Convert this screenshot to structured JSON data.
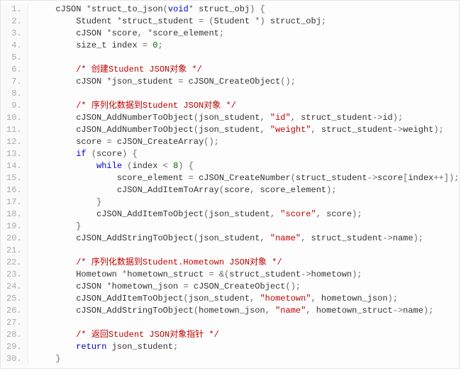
{
  "lines": [
    {
      "n": "1.",
      "indent": 1,
      "tokens": [
        [
          "ident",
          "cJSON "
        ],
        [
          "op",
          "*"
        ],
        [
          "ident",
          "struct_to_json"
        ],
        [
          "punct",
          "("
        ],
        [
          "kw-void",
          "void"
        ],
        [
          "op",
          "* "
        ],
        [
          "ident",
          "struct_obj"
        ],
        [
          "punct",
          ") {"
        ]
      ]
    },
    {
      "n": "2.",
      "indent": 2,
      "tokens": [
        [
          "ident",
          "Student "
        ],
        [
          "op",
          "*"
        ],
        [
          "ident",
          "struct_student "
        ],
        [
          "op",
          "= "
        ],
        [
          "punct",
          "("
        ],
        [
          "ident",
          "Student "
        ],
        [
          "op",
          "*"
        ],
        [
          "punct",
          ") "
        ],
        [
          "ident",
          "struct_obj"
        ],
        [
          "punct",
          ";"
        ]
      ]
    },
    {
      "n": "3.",
      "indent": 2,
      "tokens": [
        [
          "ident",
          "cJSON "
        ],
        [
          "op",
          "*"
        ],
        [
          "ident",
          "score"
        ],
        [
          "punct",
          ", "
        ],
        [
          "op",
          "*"
        ],
        [
          "ident",
          "score_element"
        ],
        [
          "punct",
          ";"
        ]
      ]
    },
    {
      "n": "4.",
      "indent": 2,
      "tokens": [
        [
          "ident",
          "size_t "
        ],
        [
          "ident",
          "index "
        ],
        [
          "op",
          "= "
        ],
        [
          "num",
          "0"
        ],
        [
          "punct",
          ";"
        ]
      ]
    },
    {
      "n": "5.",
      "indent": 0,
      "tokens": []
    },
    {
      "n": "6.",
      "indent": 2,
      "tokens": [
        [
          "comment",
          "/* 创建Student JSON对象 */"
        ]
      ]
    },
    {
      "n": "7.",
      "indent": 2,
      "tokens": [
        [
          "ident",
          "cJSON "
        ],
        [
          "op",
          "*"
        ],
        [
          "ident",
          "json_student "
        ],
        [
          "op",
          "= "
        ],
        [
          "ident",
          "cJSON_CreateObject"
        ],
        [
          "punct",
          "();"
        ]
      ]
    },
    {
      "n": "8.",
      "indent": 0,
      "tokens": []
    },
    {
      "n": "9.",
      "indent": 2,
      "tokens": [
        [
          "comment",
          "/* 序列化数据到Student JSON对象 */"
        ]
      ]
    },
    {
      "n": "10.",
      "indent": 2,
      "tokens": [
        [
          "ident",
          "cJSON_AddNumberToObject"
        ],
        [
          "punct",
          "("
        ],
        [
          "ident",
          "json_student"
        ],
        [
          "punct",
          ", "
        ],
        [
          "str",
          "\"id\""
        ],
        [
          "punct",
          ", "
        ],
        [
          "ident",
          "struct_student"
        ],
        [
          "op",
          "->"
        ],
        [
          "ident",
          "id"
        ],
        [
          "punct",
          ");"
        ]
      ]
    },
    {
      "n": "11.",
      "indent": 2,
      "tokens": [
        [
          "ident",
          "cJSON_AddNumberToObject"
        ],
        [
          "punct",
          "("
        ],
        [
          "ident",
          "json_student"
        ],
        [
          "punct",
          ", "
        ],
        [
          "str",
          "\"weight\""
        ],
        [
          "punct",
          ", "
        ],
        [
          "ident",
          "struct_student"
        ],
        [
          "op",
          "->"
        ],
        [
          "ident",
          "weight"
        ],
        [
          "punct",
          ");"
        ]
      ]
    },
    {
      "n": "12.",
      "indent": 2,
      "tokens": [
        [
          "ident",
          "score "
        ],
        [
          "op",
          "= "
        ],
        [
          "ident",
          "cJSON_CreateArray"
        ],
        [
          "punct",
          "();"
        ]
      ]
    },
    {
      "n": "13.",
      "indent": 2,
      "tokens": [
        [
          "kw-ctrl",
          "if"
        ],
        [
          "punct",
          " ("
        ],
        [
          "ident",
          "score"
        ],
        [
          "punct",
          ") {"
        ]
      ]
    },
    {
      "n": "14.",
      "indent": 3,
      "tokens": [
        [
          "kw-ctrl",
          "while"
        ],
        [
          "punct",
          " ("
        ],
        [
          "ident",
          "index "
        ],
        [
          "op",
          "< "
        ],
        [
          "num",
          "8"
        ],
        [
          "punct",
          ") {"
        ]
      ]
    },
    {
      "n": "15.",
      "indent": 4,
      "tokens": [
        [
          "ident",
          "score_element "
        ],
        [
          "op",
          "= "
        ],
        [
          "ident",
          "cJSON_CreateNumber"
        ],
        [
          "punct",
          "("
        ],
        [
          "ident",
          "struct_student"
        ],
        [
          "op",
          "->"
        ],
        [
          "ident",
          "score"
        ],
        [
          "punct",
          "["
        ],
        [
          "ident",
          "index"
        ],
        [
          "op",
          "++"
        ],
        [
          "punct",
          "]);"
        ]
      ]
    },
    {
      "n": "16.",
      "indent": 4,
      "tokens": [
        [
          "ident",
          "cJSON_AddItemToArray"
        ],
        [
          "punct",
          "("
        ],
        [
          "ident",
          "score"
        ],
        [
          "punct",
          ", "
        ],
        [
          "ident",
          "score_element"
        ],
        [
          "punct",
          ");"
        ]
      ]
    },
    {
      "n": "17.",
      "indent": 3,
      "tokens": [
        [
          "punct",
          "}"
        ]
      ]
    },
    {
      "n": "18.",
      "indent": 3,
      "tokens": [
        [
          "ident",
          "cJSON_AddItemToObject"
        ],
        [
          "punct",
          "("
        ],
        [
          "ident",
          "json_student"
        ],
        [
          "punct",
          ", "
        ],
        [
          "str",
          "\"score\""
        ],
        [
          "punct",
          ", "
        ],
        [
          "ident",
          "score"
        ],
        [
          "punct",
          ");"
        ]
      ]
    },
    {
      "n": "19.",
      "indent": 2,
      "tokens": [
        [
          "punct",
          "}"
        ]
      ]
    },
    {
      "n": "20.",
      "indent": 2,
      "tokens": [
        [
          "ident",
          "cJSON_AddStringToObject"
        ],
        [
          "punct",
          "("
        ],
        [
          "ident",
          "json_student"
        ],
        [
          "punct",
          ", "
        ],
        [
          "str",
          "\"name\""
        ],
        [
          "punct",
          ", "
        ],
        [
          "ident",
          "struct_student"
        ],
        [
          "op",
          "->"
        ],
        [
          "ident",
          "name"
        ],
        [
          "punct",
          ");"
        ]
      ]
    },
    {
      "n": "21.",
      "indent": 0,
      "tokens": []
    },
    {
      "n": "22.",
      "indent": 2,
      "tokens": [
        [
          "comment",
          "/* 序列化数据到Student.Hometown JSON对象 */"
        ]
      ]
    },
    {
      "n": "23.",
      "indent": 2,
      "tokens": [
        [
          "ident",
          "Hometown "
        ],
        [
          "op",
          "*"
        ],
        [
          "ident",
          "hometown_struct "
        ],
        [
          "op",
          "= &"
        ],
        [
          "punct",
          "("
        ],
        [
          "ident",
          "struct_student"
        ],
        [
          "op",
          "->"
        ],
        [
          "ident",
          "hometown"
        ],
        [
          "punct",
          ");"
        ]
      ]
    },
    {
      "n": "24.",
      "indent": 2,
      "tokens": [
        [
          "ident",
          "cJSON "
        ],
        [
          "op",
          "*"
        ],
        [
          "ident",
          "hometown_json "
        ],
        [
          "op",
          "= "
        ],
        [
          "ident",
          "cJSON_CreateObject"
        ],
        [
          "punct",
          "();"
        ]
      ]
    },
    {
      "n": "25.",
      "indent": 2,
      "tokens": [
        [
          "ident",
          "cJSON_AddItemToObject"
        ],
        [
          "punct",
          "("
        ],
        [
          "ident",
          "json_student"
        ],
        [
          "punct",
          ", "
        ],
        [
          "str",
          "\"hometown\""
        ],
        [
          "punct",
          ", "
        ],
        [
          "ident",
          "hometown_json"
        ],
        [
          "punct",
          ");"
        ]
      ]
    },
    {
      "n": "26.",
      "indent": 2,
      "tokens": [
        [
          "ident",
          "cJSON_AddStringToObject"
        ],
        [
          "punct",
          "("
        ],
        [
          "ident",
          "hometown_json"
        ],
        [
          "punct",
          ", "
        ],
        [
          "str",
          "\"name\""
        ],
        [
          "punct",
          ", "
        ],
        [
          "ident",
          "hometown_struct"
        ],
        [
          "op",
          "->"
        ],
        [
          "ident",
          "name"
        ],
        [
          "punct",
          ");"
        ]
      ]
    },
    {
      "n": "27.",
      "indent": 0,
      "tokens": []
    },
    {
      "n": "28.",
      "indent": 2,
      "tokens": [
        [
          "comment",
          "/* 返回Student JSON对象指针 */"
        ]
      ]
    },
    {
      "n": "29.",
      "indent": 2,
      "tokens": [
        [
          "kw-return",
          "return"
        ],
        [
          "ident",
          " json_student"
        ],
        [
          "punct",
          ";"
        ]
      ]
    },
    {
      "n": "30.",
      "indent": 1,
      "tokens": [
        [
          "punct",
          "}"
        ]
      ]
    }
  ]
}
